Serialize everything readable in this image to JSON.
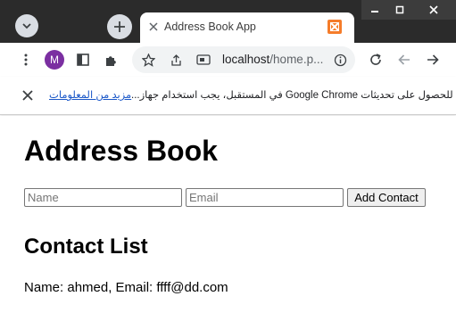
{
  "browser": {
    "tab_title": "Address Book App",
    "url_host": "localhost",
    "url_path": "/home.p...",
    "profile_initial": "M",
    "colors": {
      "frame": "#2b2b2b",
      "profile": "#7b2fa1",
      "favicon": "#f57c2a",
      "link": "#1a57c8"
    }
  },
  "infobar": {
    "message": "للحصول على تحديثات Google Chrome في المستقبل، يجب استخدام جهاز...",
    "link_text": "مزيد من المعلومات"
  },
  "page": {
    "title": "Address Book",
    "name_placeholder": "Name",
    "email_placeholder": "Email",
    "add_button_label": "Add Contact",
    "list_heading": "Contact List",
    "contacts": [
      {
        "text": "Name: ahmed, Email: ffff@dd.com"
      }
    ]
  }
}
